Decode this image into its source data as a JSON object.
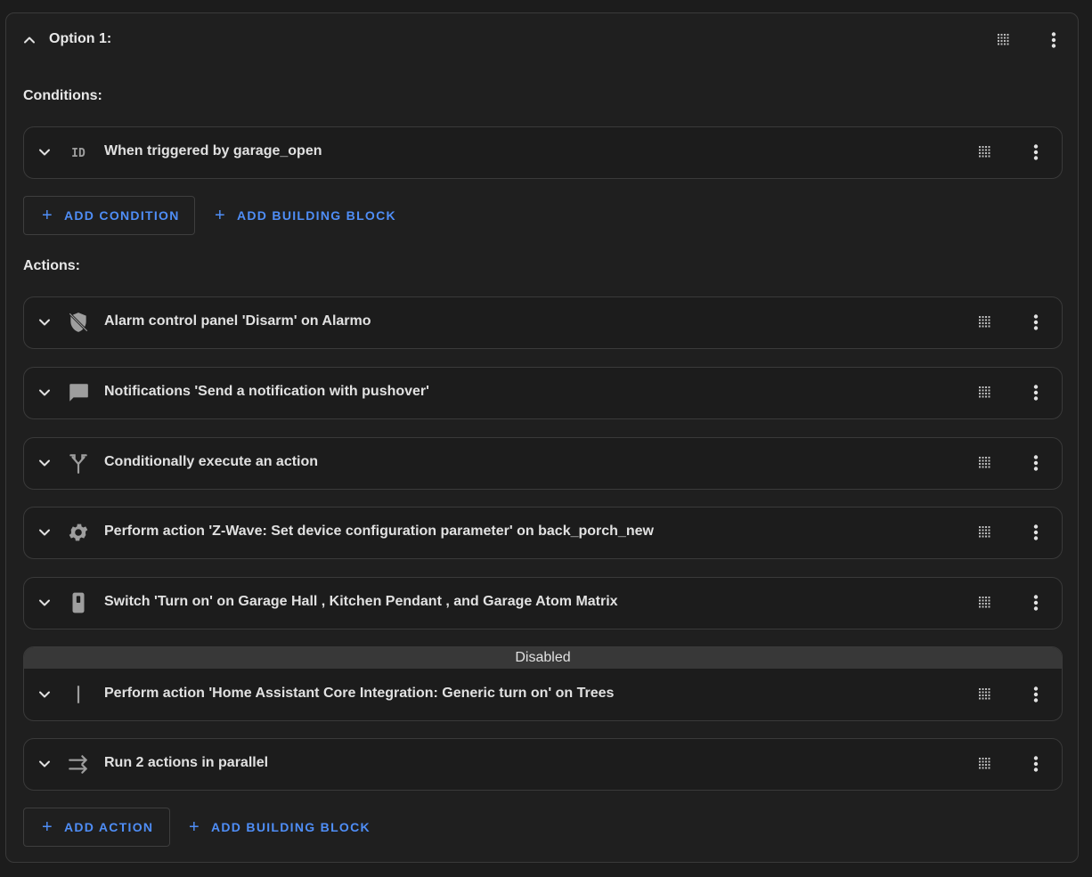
{
  "option": {
    "title": "Option 1:"
  },
  "conditions": {
    "label": "Conditions:",
    "items": [
      {
        "label": "When triggered by garage_open",
        "icon": "id-icon"
      }
    ],
    "add_condition": "ADD CONDITION",
    "add_building_block": "ADD BUILDING BLOCK"
  },
  "actions": {
    "label": "Actions:",
    "items": [
      {
        "label": "Alarm control panel 'Disarm' on Alarmo",
        "icon": "shield-off-icon"
      },
      {
        "label": "Notifications 'Send a notification with pushover'",
        "icon": "message-icon"
      },
      {
        "label": "Conditionally execute an action",
        "icon": "call-split-icon"
      },
      {
        "label": "Perform action 'Z-Wave: Set device configuration parameter' on back_porch_new",
        "icon": "gear-icon"
      },
      {
        "label": "Switch 'Turn on' on Garage Hall , Kitchen Pendant , and Garage Atom Matrix",
        "icon": "light-switch-icon"
      },
      {
        "label": "Perform action 'Home Assistant Core Integration: Generic turn on' on Trees",
        "icon": "bar-icon",
        "disabled_label": "Disabled"
      },
      {
        "label": "Run 2 actions in parallel",
        "icon": "parallel-arrows-icon"
      }
    ],
    "add_action": "ADD ACTION",
    "add_building_block": "ADD BUILDING BLOCK"
  },
  "colors": {
    "accent": "#4f8ef7",
    "background": "#1c1c1c",
    "border": "#3a3a3a",
    "disabled_banner": "#383838"
  }
}
